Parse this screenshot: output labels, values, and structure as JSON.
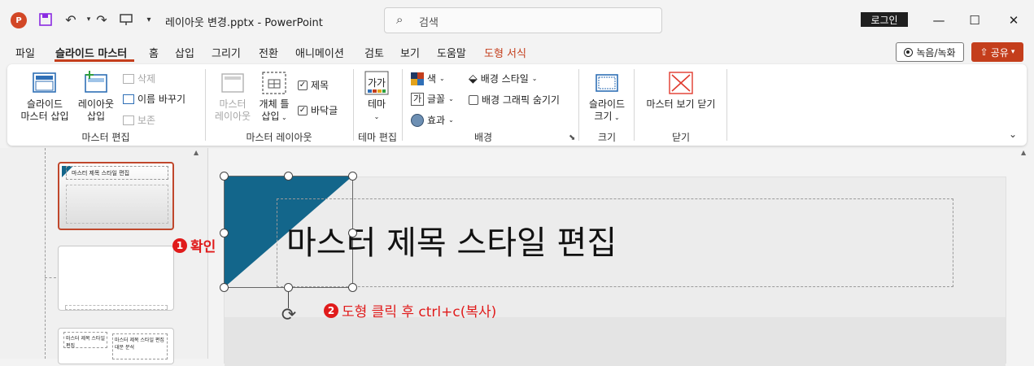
{
  "titlebar": {
    "doc_title": "레이아웃 변경.pptx  -  PowerPoint",
    "search_placeholder": "검색",
    "login": "로그인",
    "app_icon_letter": "P"
  },
  "tabs": [
    "파일",
    "슬라이드 마스터",
    "홈",
    "삽입",
    "그리기",
    "전환",
    "애니메이션",
    "검토",
    "보기",
    "도움말",
    "도형 서식"
  ],
  "record_label": "녹음/녹화",
  "share_label": "공유",
  "ribbon": {
    "master_edit": {
      "insert_master": [
        "슬라이드",
        "마스터 삽입"
      ],
      "insert_layout": [
        "레이아웃",
        "삽입"
      ],
      "delete": "삭제",
      "rename": "이름 바꾸기",
      "preserve": "보존",
      "group": "마스터 편집"
    },
    "master_layout": {
      "master_layout_btn": [
        "마스터",
        "레이아웃"
      ],
      "insert_placeholder": [
        "개체 틀",
        "삽입"
      ],
      "title_check": "제목",
      "footer_check": "바닥글",
      "group": "마스터 레이아웃"
    },
    "theme": {
      "theme_btn": "테마",
      "group": "테마 편집"
    },
    "background": {
      "colors": "색",
      "fonts": "글꼴",
      "effects": "효과",
      "bg_styles": "배경 스타일",
      "hide_bg": "배경 그래픽 숨기기",
      "group": "배경"
    },
    "size": {
      "slide_size": [
        "슬라이드",
        "크기"
      ],
      "group": "크기"
    },
    "close": {
      "close_master": "마스터 보기 닫기",
      "group": "닫기"
    }
  },
  "slide": {
    "title_text": "마스터 제목 스타일 편집",
    "shape_color": "#13668b"
  },
  "thumbnails": {
    "thumb1_text": "마스터 제목 스타일 편집",
    "thumb3_text1": "마스터 제목 스타일 편집",
    "thumb3_text2": "마스터 제목 스타일 편집",
    "thumb3_text3": "대문 분석"
  },
  "annotations": {
    "a1_num": "❶",
    "a1_text": "확인",
    "a2_num": "❷",
    "a2_text": "도형 클릭 후 ctrl+c(복사)"
  },
  "accent": "#c43e1c"
}
